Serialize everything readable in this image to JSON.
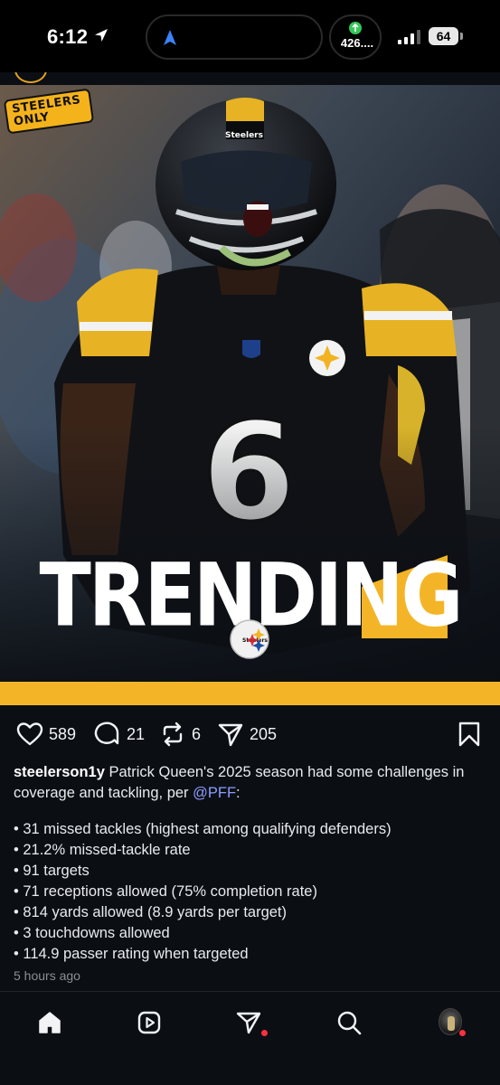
{
  "status_bar": {
    "time": "6:12",
    "activity_value": "426....",
    "battery": "64"
  },
  "post_image": {
    "brand_line1": "STEELERS",
    "brand_line2": "ONLY",
    "headline": "TRENDING",
    "jersey_number": "6",
    "accent_color": "#f3b527"
  },
  "actions": {
    "likes": "589",
    "comments": "21",
    "reposts": "6",
    "shares": "205"
  },
  "caption": {
    "username": "steelerson1y",
    "text_before_mention": " Patrick Queen's 2025 season had some challenges in coverage and tackling, per ",
    "mention": "@PFF",
    "text_after_mention": ":",
    "bullets": [
      "• 31 missed tackles (highest among qualifying defenders)",
      "• 21.2% missed-tackle rate",
      "• 91 targets",
      "• 71 receptions allowed (75% completion rate)",
      "• 814 yards allowed (8.9 yards per target)",
      "• 3 touchdowns allowed",
      "• 114.9 passer rating when targeted"
    ],
    "timestamp": "5 hours ago"
  },
  "bottom_nav": {
    "items": [
      "home-icon",
      "reels-icon",
      "direct-message-icon",
      "search-icon",
      "profile-avatar"
    ]
  }
}
